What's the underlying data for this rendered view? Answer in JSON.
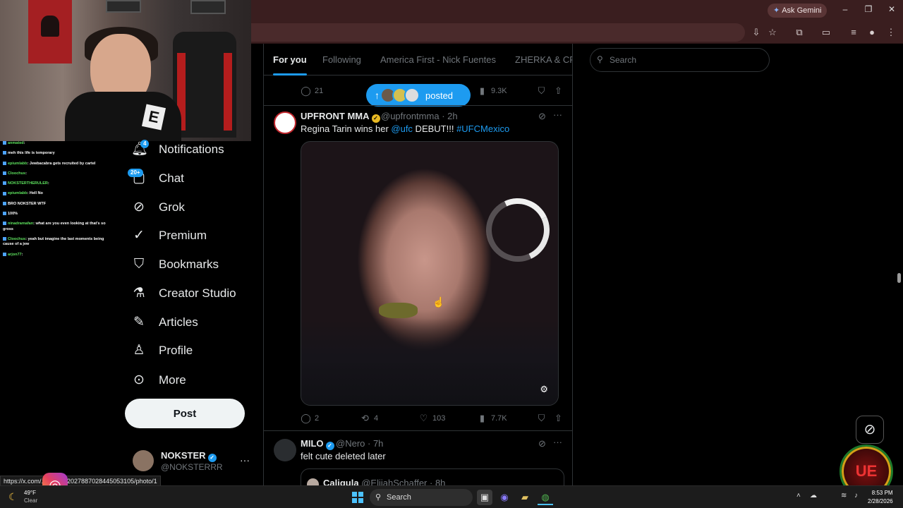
{
  "browser": {
    "gemini_label": "Ask Gemini",
    "window_controls": [
      "minimize-icon",
      "restore-icon",
      "close-icon"
    ]
  },
  "stream_chat": [
    {
      "user": "anmated",
      "text": ""
    },
    {
      "user": "",
      "text": "meh this life is temporary"
    },
    {
      "user": "epiumlabb",
      "text": "Jewbacabra gets recruited by cartel"
    },
    {
      "user": "Cloochus",
      "text": ""
    },
    {
      "user": "NOKSTERTHERULER",
      "text": ""
    },
    {
      "user": "epiumlabb",
      "text": "Hell No"
    },
    {
      "user": "",
      "text": "BRO NOKSTER WTF"
    },
    {
      "user": "",
      "text": "100%"
    },
    {
      "user": "ninadramafan",
      "text": "what are you even looking at that's so gross"
    },
    {
      "user": "Cloochus",
      "text": "yeah but imagine the last moments being cause of a jew"
    },
    {
      "user": "arjon77",
      "text": ""
    }
  ],
  "nav": {
    "items": [
      {
        "label": "Notifications",
        "icon": "bell-icon",
        "badge": "4"
      },
      {
        "label": "Chat",
        "icon": "chat-icon",
        "badge": "20+"
      },
      {
        "label": "Grok",
        "icon": "grok-icon"
      },
      {
        "label": "Premium",
        "icon": "premium-icon"
      },
      {
        "label": "Bookmarks",
        "icon": "bookmark-icon"
      },
      {
        "label": "Creator Studio",
        "icon": "flask-icon"
      },
      {
        "label": "Articles",
        "icon": "articles-icon"
      },
      {
        "label": "Profile",
        "icon": "profile-icon"
      },
      {
        "label": "More",
        "icon": "more-circle-icon"
      }
    ],
    "post_label": "Post",
    "account": {
      "name": "NOKSTER",
      "handle": "@NOKSTERRR"
    }
  },
  "tabs": [
    "For you",
    "Following",
    "America First - Nick Fuentes",
    "ZHERKA & CRI"
  ],
  "new_posts_pill": "posted",
  "prev_tweet_actions": {
    "replies": "21",
    "views": "9.3K"
  },
  "tweets": [
    {
      "name": "UPFRONT MMA",
      "handle": "@upfrontmma",
      "time": "· 2h",
      "text_pre": "Regina Tarin wins her ",
      "mention": "@ufc",
      "text_mid": " DEBUT!!! ",
      "hashtag": "#UFCMexico",
      "replies": "2",
      "reposts": "4",
      "likes": "103",
      "views": "7.7K"
    },
    {
      "name": "MILO",
      "handle": "@Nero",
      "time": "· 7h",
      "text": "felt cute deleted later",
      "quote": {
        "name": "Caligula",
        "handle": "@ElijahSchaffer",
        "time": "· 8h"
      }
    }
  ],
  "search": {
    "placeholder": "Search"
  },
  "status_url": "https://x.com/.../status/2027887028445053105/photo/1",
  "taskbar": {
    "weather_temp": "49°F",
    "weather_cond": "Clear",
    "search_label": "Search",
    "time": "8:53 PM",
    "date": "2/28/2026"
  },
  "colors": {
    "accent": "#1d9bf0",
    "background": "#000000",
    "browser_frame": "#3a1e1f"
  }
}
